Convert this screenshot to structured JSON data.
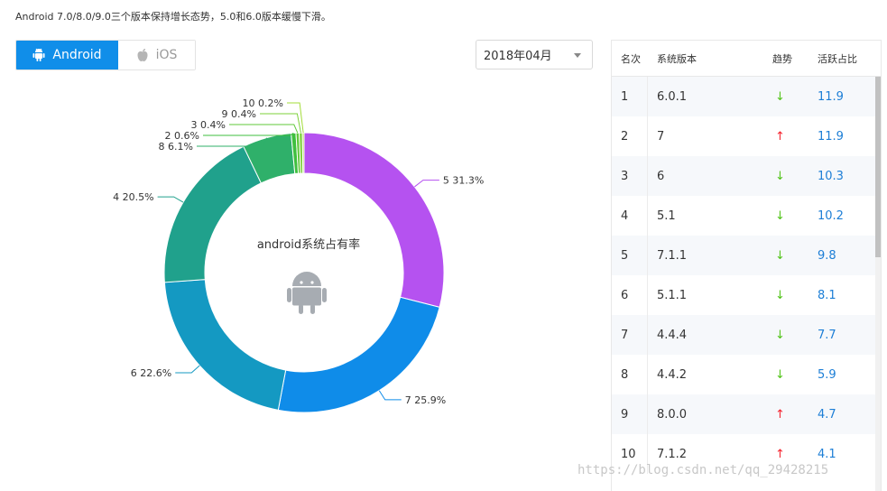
{
  "headline": "Android 7.0/8.0/9.0三个版本保持增长态势，5.0和6.0版本缓慢下滑。",
  "tabs": [
    {
      "label": "Android",
      "icon": "android-icon",
      "active": true
    },
    {
      "label": "iOS",
      "icon": "apple-icon",
      "active": false
    }
  ],
  "month_select": {
    "value": "2018年04月"
  },
  "chart_data": {
    "type": "pie",
    "title": "android系统占有率",
    "slices": [
      {
        "label": "5",
        "value": 31.3,
        "color": "#b552f0"
      },
      {
        "label": "7",
        "value": 25.9,
        "color": "#0f8ce9"
      },
      {
        "label": "6",
        "value": 22.6,
        "color": "#1499c2"
      },
      {
        "label": "4",
        "value": 20.5,
        "color": "#20a18c"
      },
      {
        "label": "8",
        "value": 6.1,
        "color": "#2fb06a"
      },
      {
        "label": "2",
        "value": 0.6,
        "color": "#3fbf3f"
      },
      {
        "label": "3",
        "value": 0.4,
        "color": "#5fc93a"
      },
      {
        "label": "9",
        "value": 0.4,
        "color": "#7dd23a"
      },
      {
        "label": "10",
        "value": 0.2,
        "color": "#a3dc38"
      }
    ]
  },
  "table": {
    "headers": {
      "rank": "名次",
      "version": "系统版本",
      "trend": "趋势",
      "share": "活跃占比"
    },
    "rows": [
      {
        "rank": "1",
        "version": "6.0.1",
        "trend": "down",
        "share": "11.9"
      },
      {
        "rank": "2",
        "version": "7",
        "trend": "up",
        "share": "11.9"
      },
      {
        "rank": "3",
        "version": "6",
        "trend": "down",
        "share": "10.3"
      },
      {
        "rank": "4",
        "version": "5.1",
        "trend": "down",
        "share": "10.2"
      },
      {
        "rank": "5",
        "version": "7.1.1",
        "trend": "down",
        "share": "9.8"
      },
      {
        "rank": "6",
        "version": "5.1.1",
        "trend": "down",
        "share": "8.1"
      },
      {
        "rank": "7",
        "version": "4.4.4",
        "trend": "down",
        "share": "7.7"
      },
      {
        "rank": "8",
        "version": "4.4.2",
        "trend": "down",
        "share": "5.9"
      },
      {
        "rank": "9",
        "version": "8.0.0",
        "trend": "up",
        "share": "4.7"
      },
      {
        "rank": "10",
        "version": "7.1.2",
        "trend": "up",
        "share": "4.1"
      }
    ]
  },
  "watermark": "https://blog.csdn.net/qq_29428215"
}
